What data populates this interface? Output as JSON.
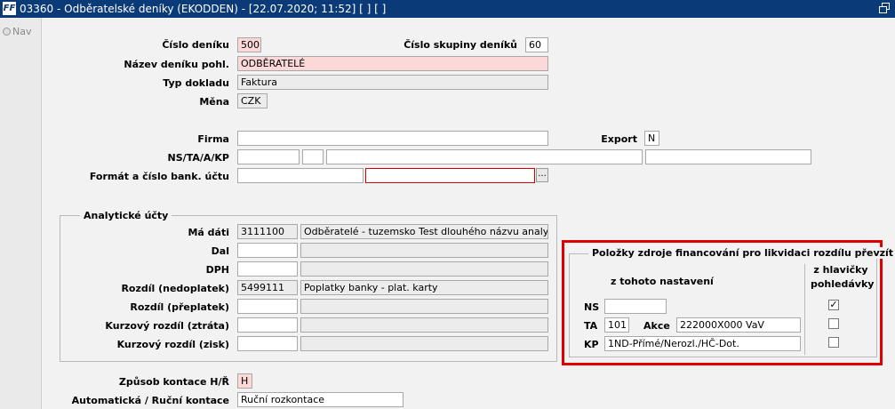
{
  "window": {
    "title": "03360 - Odběratelské deníky (EKODDEN) - [22.07.2020; 11:52] [ ] [ ]",
    "app_icon": "FF"
  },
  "nav": {
    "label": "Nav"
  },
  "form": {
    "cislo_deniku": {
      "label": "Číslo deníku",
      "value": "500"
    },
    "cislo_skupiny": {
      "label": "Číslo skupiny deníků",
      "value": "60"
    },
    "nazev_deniku": {
      "label": "Název deníku pohl.",
      "value": "ODBĚRATELÉ"
    },
    "typ_dokladu": {
      "label": "Typ dokladu",
      "value": "Faktura"
    },
    "mena": {
      "label": "Měna",
      "value": "CZK"
    },
    "firma": {
      "label": "Firma",
      "value": ""
    },
    "export": {
      "label": "Export",
      "value": "N"
    },
    "ns_ta_a_kp": {
      "label": "NS/TA/A/KP"
    },
    "format_uctu": {
      "label": "Formát a číslo bank. účtu",
      "button": "..."
    }
  },
  "analytic": {
    "title": "Analytické účty",
    "rows": [
      {
        "label": "Má dáti",
        "code": "3111100",
        "desc": "Odběratelé - tuzemsko Test dlouhého názvu analytického"
      },
      {
        "label": "Dal",
        "code": "",
        "desc": ""
      },
      {
        "label": "DPH",
        "code": "",
        "desc": ""
      },
      {
        "label": "Rozdíl (nedoplatek)",
        "code": "5499111",
        "desc": "Poplatky banky - plat. karty"
      },
      {
        "label": "Rozdíl (přeplatek)",
        "code": "",
        "desc": ""
      },
      {
        "label": "Kurzový rozdíl (ztráta)",
        "code": "",
        "desc": ""
      },
      {
        "label": "Kurzový rozdíl (zisk)",
        "code": "",
        "desc": ""
      }
    ]
  },
  "financing": {
    "title": "Položky zdroje financování pro likvidaci rozdílu převzít",
    "col_left": "z tohoto nastavení",
    "col_right_1": "z hlavičky",
    "col_right_2": "pohledávky",
    "ns": {
      "label": "NS",
      "value": "",
      "checked": true
    },
    "ta": {
      "label": "TA",
      "value": "101",
      "akce_label": "Akce",
      "akce_value": "222000X000 VaV",
      "checked": false
    },
    "kp": {
      "label": "KP",
      "value": "1ND-Přímé/Nerozl./HČ-Dot.",
      "checked": false
    },
    "check_mark": "✓"
  },
  "bottom": {
    "zpusob_kontace": {
      "label": "Způsob kontace H/Ř",
      "value": "H"
    },
    "automaticka": {
      "label": "Automatická / Ruční kontace",
      "value": "Ruční rozkontace"
    }
  },
  "colors": {
    "titlebar": "#0b3a78",
    "highlight_border": "#e00000",
    "required_field": "#fcd8d8"
  }
}
